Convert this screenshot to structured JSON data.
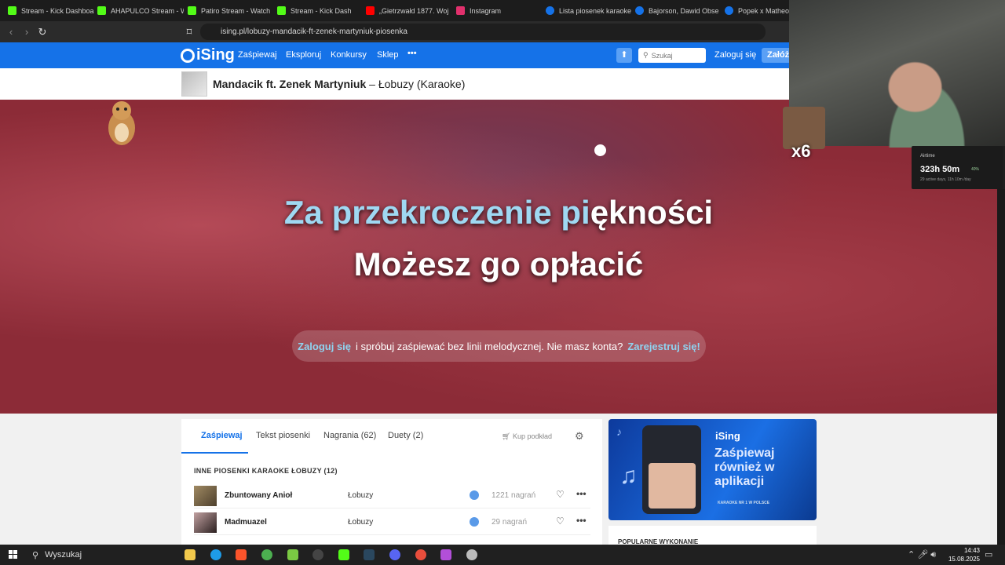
{
  "browser": {
    "tabs": [
      {
        "label": "Stream - Kick Dashboa",
        "color": "#53fc18"
      },
      {
        "label": "AHAPULCO Stream - W",
        "color": "#53fc18"
      },
      {
        "label": "Patiro Stream - Watch",
        "color": "#53fc18"
      },
      {
        "label": "Stream - Kick Dash",
        "color": "#53fc18"
      },
      {
        "label": "„Gietrzwałd 1877. Woj",
        "color": "#ff0000"
      },
      {
        "label": "Instagram",
        "color": "#e1306c"
      },
      {
        "label": "Lista piosenek karaoke",
        "color": "#1572e8"
      },
      {
        "label": "Bajorson, Dawid Obse",
        "color": "#1572e8"
      },
      {
        "label": "Popek x Matheo – W",
        "color": "#1572e8"
      }
    ],
    "url": "ising.pl/lobuzy-mandacik-ft-zenek-martyniuk-piosenka"
  },
  "site": {
    "logo": "iSing",
    "nav": [
      "Zaśpiewaj",
      "Eksploruj",
      "Konkursy",
      "Sklep",
      "•••"
    ],
    "search_placeholder": "Szukaj",
    "login": "Zaloguj się",
    "register": "Załóż"
  },
  "song": {
    "artist": "Mandacik ft. Zenek Martyniuk",
    "separator": " – ",
    "title": "Łobuzy (Karaoke)"
  },
  "lyrics": {
    "line1_sung": "Za przekroczenie pi",
    "line1_rest": "ękności",
    "line2": "Możesz go opłacić"
  },
  "notice": {
    "login": "Zaloguj się",
    "middle": "i spróbuj zaśpiewać bez linii melodycznej. Nie masz konta?",
    "register": "Zarejestruj się!"
  },
  "tabs": {
    "sing": "Zaśpiewaj",
    "lyrics": "Tekst piosenki",
    "recordings": "Nagrania (62)",
    "duets": "Duety (2)",
    "buy": "Kup podkład"
  },
  "list": {
    "header": "INNE PIOSENKI KARAOKE ŁOBUZY (12)",
    "rows": [
      {
        "title": "Zbuntowany Anioł",
        "artist": "Łobuzy",
        "count": "1221 nagrań"
      },
      {
        "title": "Madmuazel",
        "artist": "Łobuzy",
        "count": "29 nagrań"
      }
    ]
  },
  "ad": {
    "logo": "iSing",
    "title": "Zaśpiewaj również w aplikacji",
    "subtitle": "KARAOKE NR 1 W POLSCE"
  },
  "popular": "POPULARNE WYKONANIE",
  "overlay": {
    "emote_count": "x6",
    "stats_label": "Airtime",
    "stats_value": "323h 50m",
    "stats_pct": "40%",
    "stats_sub": "29 active days, 11h 10m /day"
  },
  "taskbar": {
    "search": "Wyszukaj",
    "time": "14:43",
    "date": "15.08.2025"
  }
}
